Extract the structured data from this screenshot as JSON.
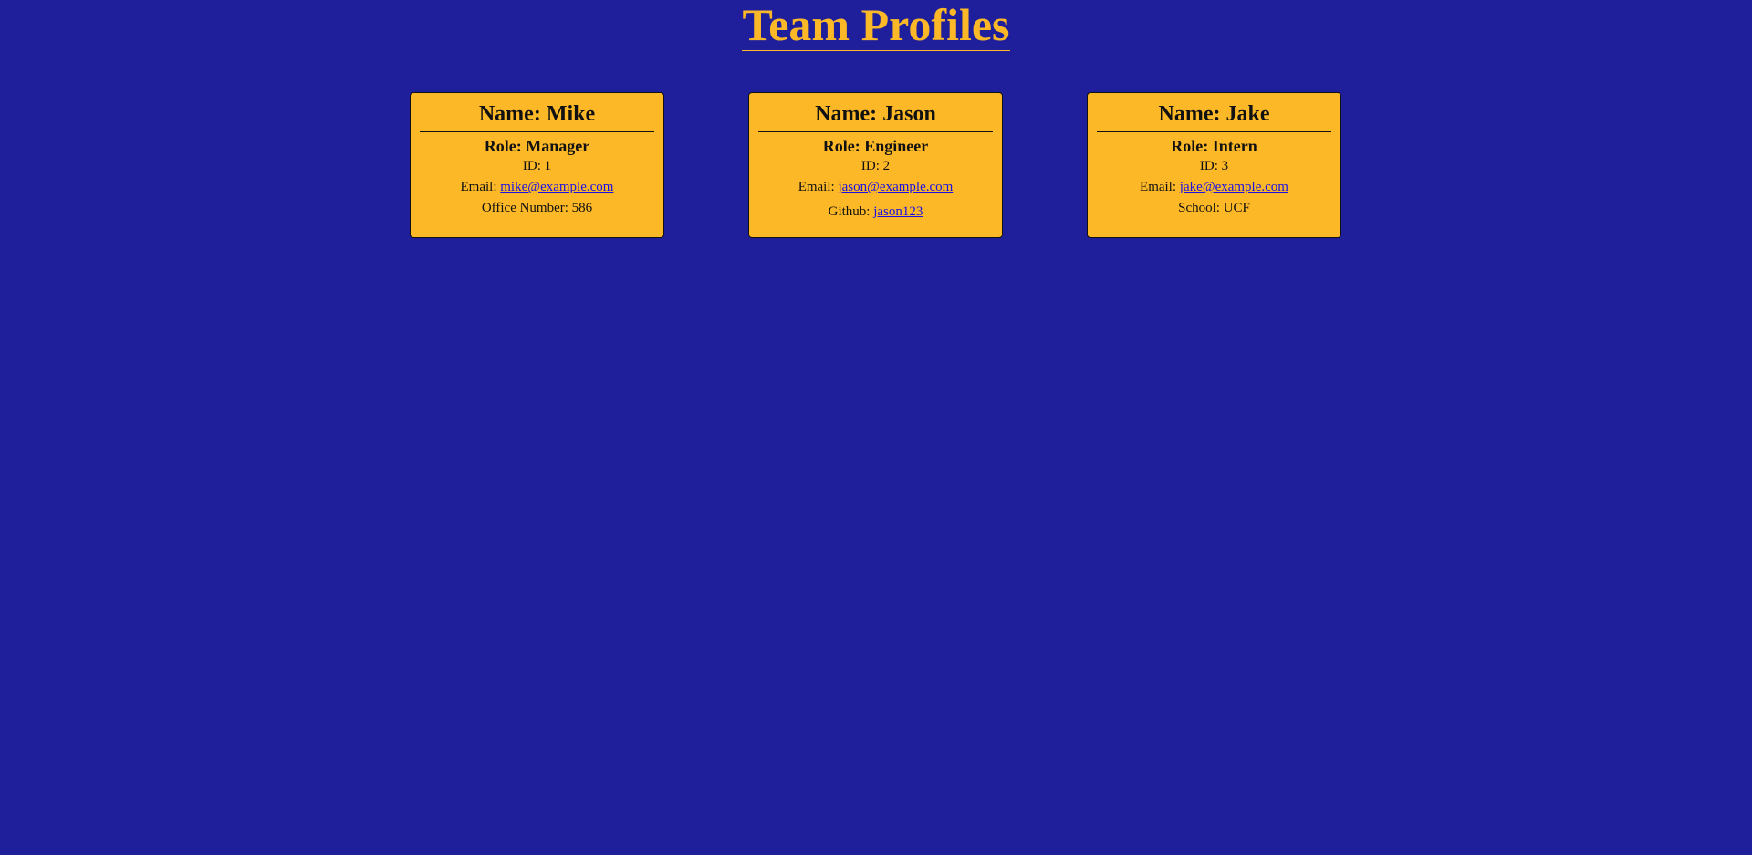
{
  "title": "Team Profiles",
  "colors": {
    "background": "#1f1f9c",
    "accent": "#fcb827",
    "link": "#1a10e6"
  },
  "cards": [
    {
      "name": "Name: Mike",
      "role": "Role: Manager",
      "id": "ID: 1",
      "email_label": "Email:",
      "email": "mike@example.com",
      "extra_label": "Office Number: 586"
    },
    {
      "name": "Name: Jason",
      "role": "Role: Engineer",
      "id": "ID: 2",
      "email_label": "Email:",
      "email": "jason@example.com",
      "extra_label": "Github:",
      "extra_link": "jason123"
    },
    {
      "name": "Name: Jake",
      "role": "Role: Intern",
      "id": "ID: 3",
      "email_label": "Email:",
      "email": "jake@example.com",
      "extra_label": "School: UCF"
    }
  ]
}
